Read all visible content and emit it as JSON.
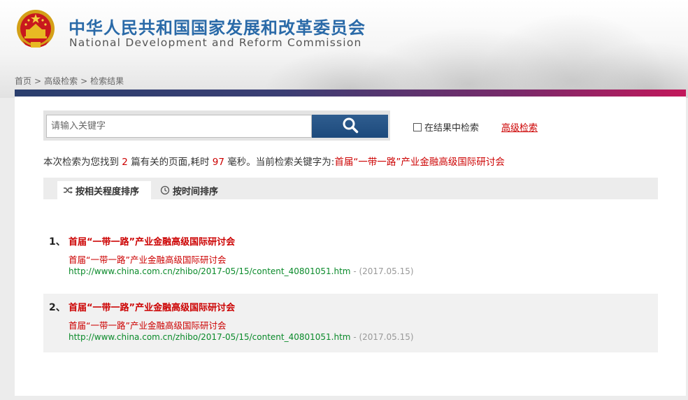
{
  "header": {
    "title_cn": "中华人民共和国国家发展和改革委员会",
    "title_en": "National Development and Reform Commission",
    "emblem_icon": "national-emblem-icon"
  },
  "breadcrumb": {
    "home": "首页",
    "advanced": "高级检索",
    "results": "检索结果",
    "separator": ">"
  },
  "search": {
    "placeholder": "请输入关键字",
    "value": "",
    "button_icon": "search-icon",
    "in_results_label": "在结果中检索",
    "in_results_checked": false,
    "advanced_link": "高级检索"
  },
  "summary": {
    "prefix": "本次检索为您找到",
    "count": "2",
    "mid1": "篇有关的页面,耗时",
    "time": "97",
    "mid2": "毫秒。当前检索关键字为:",
    "keyword": "首届“一带一路”产业金融高级国际研讨会"
  },
  "sort": {
    "relevance": "按相关程度排序",
    "time": "按时间排序",
    "relevance_icon": "shuffle-icon",
    "time_icon": "clock-icon"
  },
  "results": [
    {
      "num": "1、",
      "title": "首届“一带一路”产业金融高级国际研讨会",
      "snippet": "首届“一带一路”产业金融高级国际研讨会",
      "url": "http://www.china.com.cn/zhibo/2017-05/15/content_40801051.htm",
      "date": " - (2017.05.15)"
    },
    {
      "num": "2、",
      "title": "首届“一带一路”产业金融高级国际研讨会",
      "snippet": "首届“一带一路”产业金融高级国际研讨会",
      "url": "http://www.china.com.cn/zhibo/2017-05/15/content_40801051.htm",
      "date": " - (2017.05.15)"
    }
  ],
  "colors": {
    "accent_blue": "#2a6aa8",
    "link_red": "#cc0000",
    "url_green": "#0a8a2a"
  }
}
